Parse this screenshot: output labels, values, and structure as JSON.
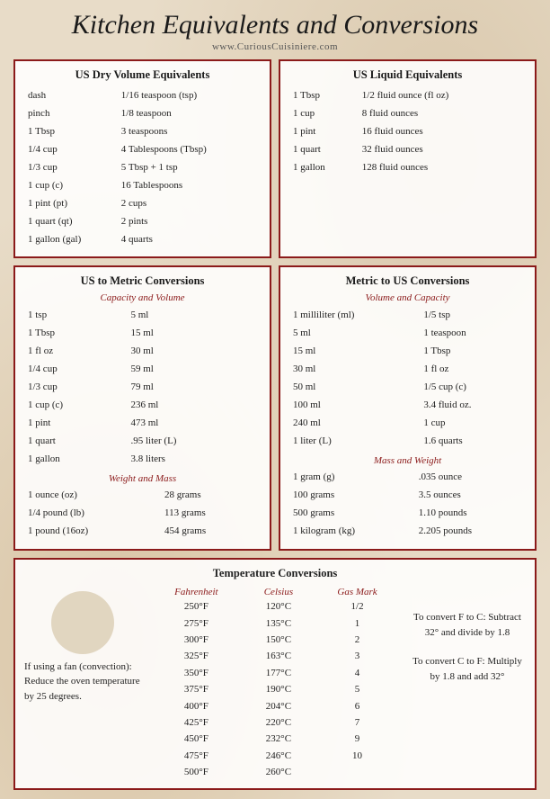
{
  "header": {
    "title": "Kitchen Equivalents and Conversions",
    "subtitle": "www.CuriousCuisiniere.com"
  },
  "dry_volume": {
    "title": "US Dry Volume Equivalents",
    "rows": [
      [
        "dash",
        "1/16 teaspoon (tsp)"
      ],
      [
        "pinch",
        "1/8 teaspoon"
      ],
      [
        "1 Tbsp",
        "3 teaspoons"
      ],
      [
        "1/4 cup",
        "4 Tablespoons (Tbsp)"
      ],
      [
        "1/3 cup",
        "5 Tbsp + 1 tsp"
      ],
      [
        "1 cup (c)",
        "16 Tablespoons"
      ],
      [
        "1 pint (pt)",
        "2 cups"
      ],
      [
        "1 quart (qt)",
        "2 pints"
      ],
      [
        "1 gallon (gal)",
        "4 quarts"
      ]
    ]
  },
  "liquid_equiv": {
    "title": "US Liquid Equivalents",
    "rows": [
      [
        "1 Tbsp",
        "1/2 fluid ounce (fl oz)"
      ],
      [
        "1 cup",
        "8 fluid ounces"
      ],
      [
        "1 pint",
        "16 fluid ounces"
      ],
      [
        "1 quart",
        "32 fluid ounces"
      ],
      [
        "1 gallon",
        "128 fluid ounces"
      ]
    ]
  },
  "us_to_metric": {
    "title": "US to Metric Conversions",
    "subtitle_cap": "Capacity and Volume",
    "cap_rows": [
      [
        "1 tsp",
        "5 ml"
      ],
      [
        "1 Tbsp",
        "15 ml"
      ],
      [
        "1 fl oz",
        "30 ml"
      ],
      [
        "1/4 cup",
        "59 ml"
      ],
      [
        "1/3 cup",
        "79 ml"
      ],
      [
        "1 cup (c)",
        "236 ml"
      ],
      [
        "1 pint",
        "473 ml"
      ],
      [
        "1 quart",
        ".95 liter (L)"
      ],
      [
        "1 gallon",
        "3.8 liters"
      ]
    ],
    "subtitle_wt": "Weight and Mass",
    "wt_rows": [
      [
        "1 ounce (oz)",
        "28 grams"
      ],
      [
        "1/4 pound (lb)",
        "113 grams"
      ],
      [
        "1 pound (16oz)",
        "454 grams"
      ]
    ]
  },
  "metric_to_us": {
    "title": "Metric to US Conversions",
    "subtitle_cap": "Volume and Capacity",
    "cap_rows": [
      [
        "1 milliliter (ml)",
        "1/5 tsp"
      ],
      [
        "5 ml",
        "1 teaspoon"
      ],
      [
        "15 ml",
        "1 Tbsp"
      ],
      [
        "30 ml",
        "1 fl oz"
      ],
      [
        "50 ml",
        "1/5 cup (c)"
      ],
      [
        "100 ml",
        "3.4 fluid oz."
      ],
      [
        "240 ml",
        "1 cup"
      ],
      [
        "1 liter (L)",
        "1.6 quarts"
      ]
    ],
    "subtitle_wt": "Mass and Weight",
    "wt_rows": [
      [
        "1 gram (g)",
        ".035 ounce"
      ],
      [
        "100 grams",
        "3.5 ounces"
      ],
      [
        "500 grams",
        "1.10 pounds"
      ],
      [
        "1 kilogram (kg)",
        "2.205 pounds"
      ]
    ]
  },
  "temperature": {
    "title": "Temperature Conversions",
    "col_headers": [
      "Fahrenheit",
      "Celsius",
      "Gas Mark"
    ],
    "rows": [
      [
        "250°F",
        "120°C",
        "1/2"
      ],
      [
        "275°F",
        "135°C",
        "1"
      ],
      [
        "300°F",
        "150°C",
        "2"
      ],
      [
        "325°F",
        "163°C",
        "3"
      ],
      [
        "350°F",
        "177°C",
        "4"
      ],
      [
        "375°F",
        "190°C",
        "5"
      ],
      [
        "400°F",
        "204°C",
        "6"
      ],
      [
        "425°F",
        "220°C",
        "7"
      ],
      [
        "450°F",
        "232°C",
        "9"
      ],
      [
        "475°F",
        "246°C",
        "10"
      ],
      [
        "500°F",
        "260°C",
        ""
      ]
    ]
  },
  "fan_note": "If using a fan (convection): Reduce the oven temperature by 25 degrees.",
  "f_to_c": "To convert F to C: Subtract 32° and divide by 1.8",
  "c_to_f": "To convert C to F: Multiply by 1.8 and add 32°"
}
